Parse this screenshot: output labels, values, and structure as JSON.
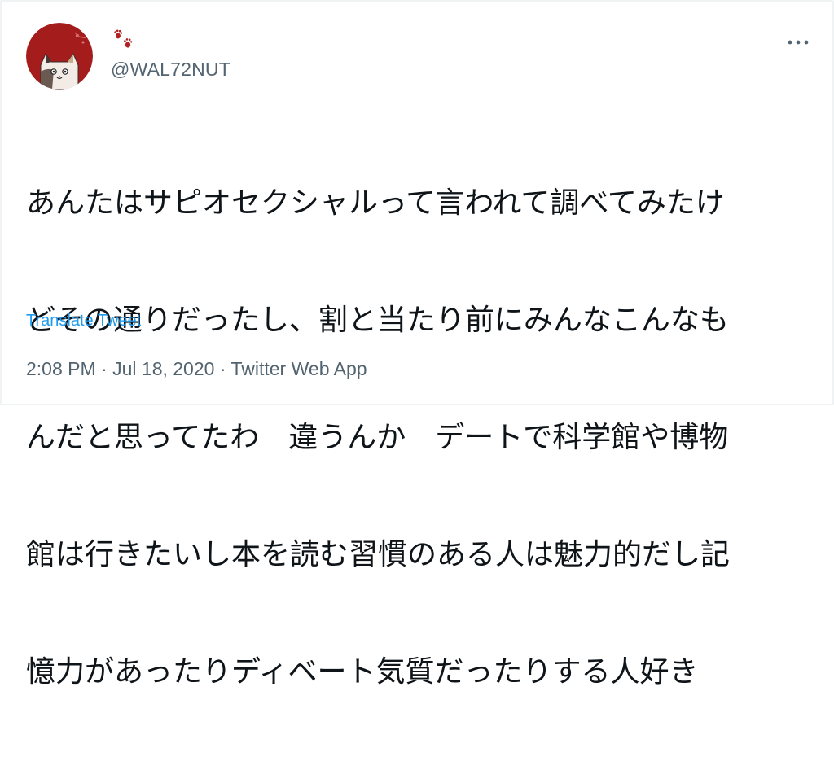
{
  "tweet": {
    "display_name_icon": "paw-prints-icon",
    "handle": "@WAL72NUT",
    "text_lines": [
      "あんたはサピオセクシャルって言われて調べてみたけ",
      "どその通りだったし、割と当たり前にみんなこんなも",
      "んだと思ってたわ　違うんか　デートで科学館や博物",
      "館は行きたいし本を読む習慣のある人は魅力的だし記",
      "憶力があったりディベート気質だったりする人好き"
    ],
    "translate_label": "Translate Tweet",
    "time": "2:08 PM",
    "separator": "·",
    "date": "Jul 18, 2020",
    "source": "Twitter Web App"
  },
  "colors": {
    "text_primary": "#0f1419",
    "text_secondary": "#536471",
    "link_blue": "#1d9bf0",
    "avatar_red": "#a51c1c",
    "paw_red": "#b22222"
  }
}
